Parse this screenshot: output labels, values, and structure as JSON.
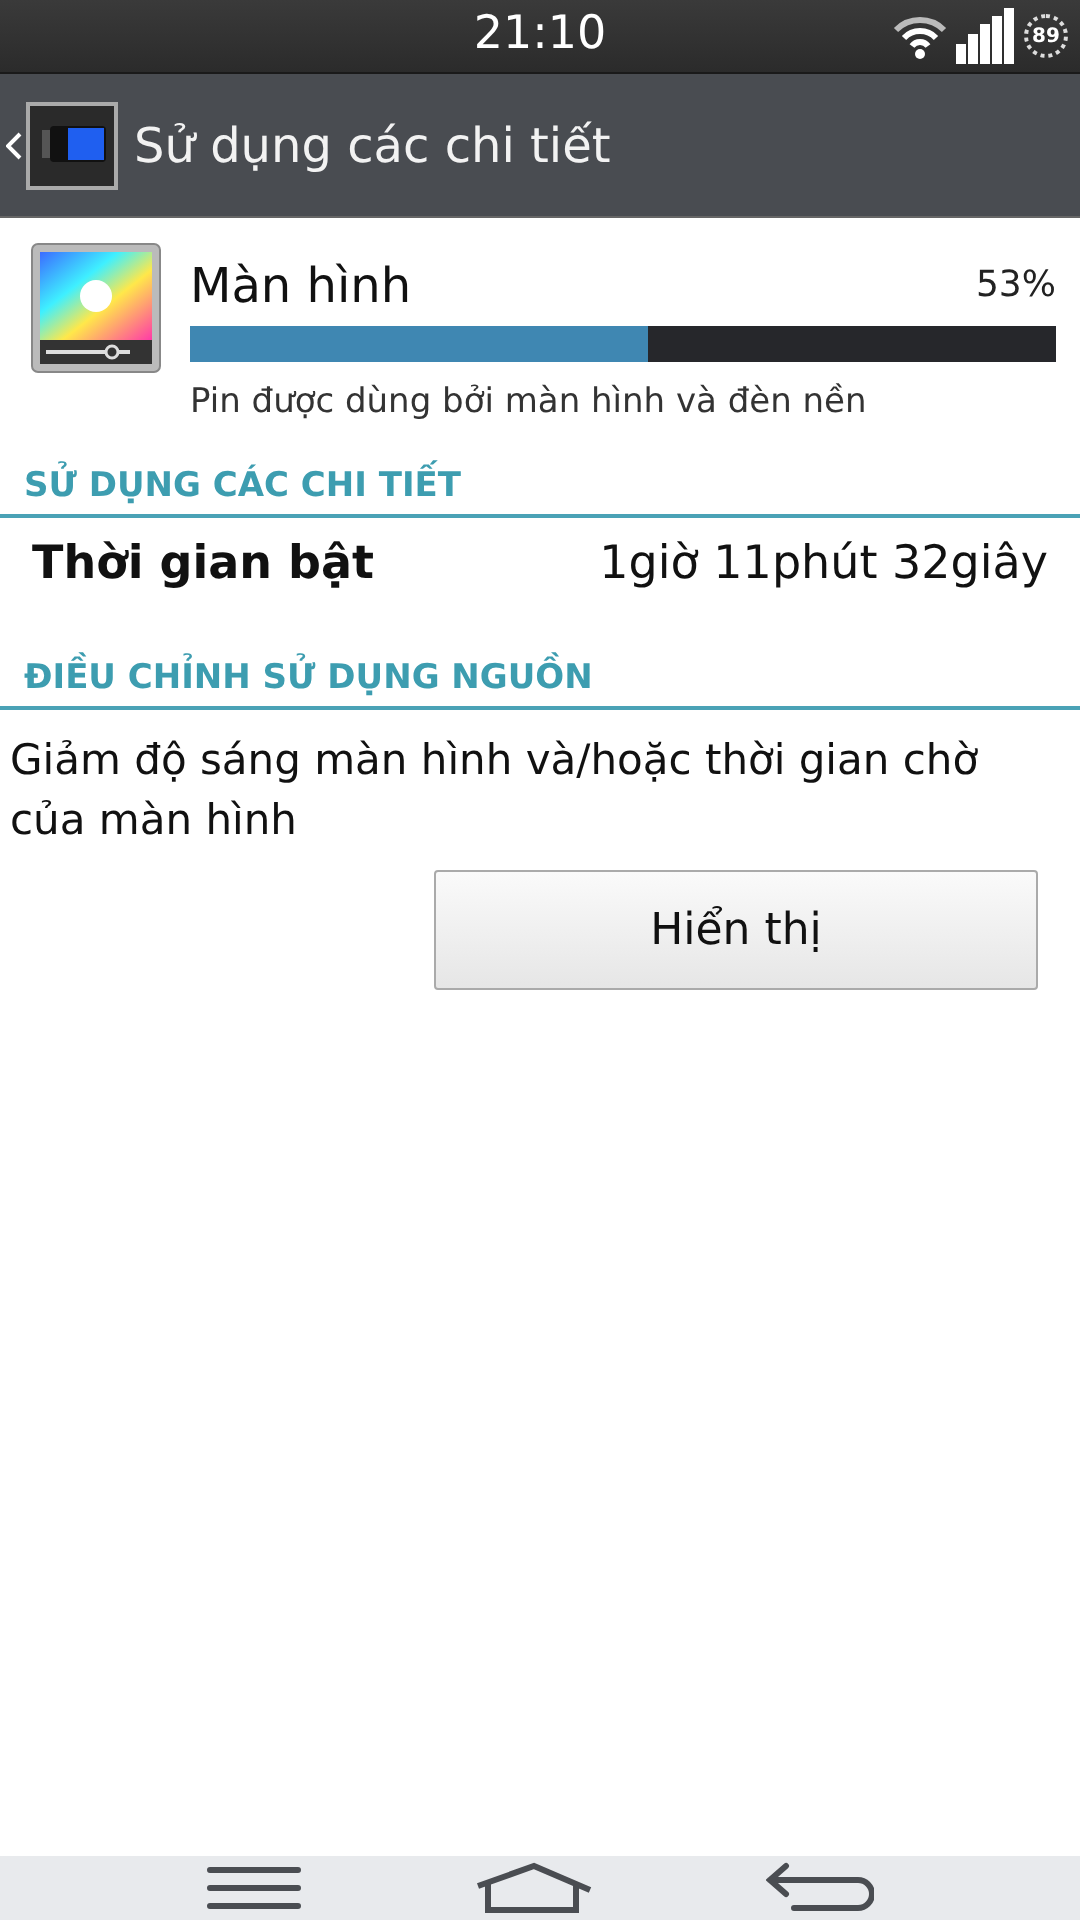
{
  "status_bar": {
    "time": "21:10",
    "battery": "89"
  },
  "action_bar": {
    "title": "Sử dụng các chi tiết"
  },
  "usage": {
    "name": "Màn hình",
    "percent": "53%",
    "level": 0.53,
    "description": "Pin được dùng bởi màn hình và đèn nền"
  },
  "details": {
    "header": "SỬ DỤNG CÁC CHI TIẾT",
    "rows": [
      {
        "label": "Thời gian bật",
        "value": "1giờ 11phút 32giây"
      }
    ]
  },
  "adjust": {
    "header": "ĐIỀU CHỈNH SỬ DỤNG NGUỒN",
    "text": "Giảm độ sáng màn hình và/hoặc thời gian chờ của màn hình",
    "button": "Hiển thị"
  }
}
